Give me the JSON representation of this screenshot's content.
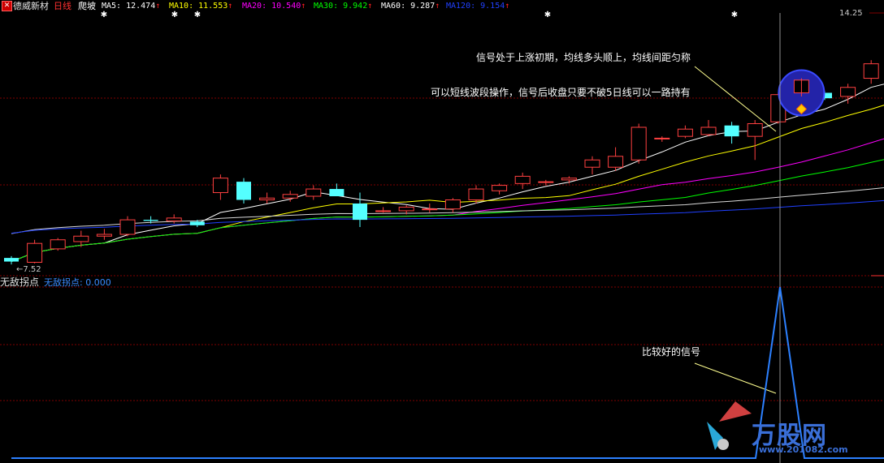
{
  "header": {
    "icon": "stock-close-icon",
    "stock_name": "德威新材",
    "period": "日线",
    "formula_name": "爬坡",
    "ma": [
      {
        "label": "MA5: 12.474",
        "color": "#ffffff"
      },
      {
        "label": "MA10: 11.553",
        "color": "#ffff00"
      },
      {
        "label": "MA20: 10.540",
        "color": "#ff00ff"
      },
      {
        "label": "MA30: 9.942",
        "color": "#00ff00"
      },
      {
        "label": "MA60: 9.287",
        "color": "#ffffff"
      },
      {
        "label": "MA120: 9.154",
        "color": "#2040ff"
      }
    ],
    "arrow": "↑",
    "arrow_color": "#ff2020"
  },
  "price_panel": {
    "high_label": "14.25",
    "low_label": "7.52",
    "annotations": {
      "note1": "信号处于上涨初期，均线多头顺上，均线间距匀称",
      "note2": "可以短线波段操作，信号后收盘只要不破5日线可以一路持有"
    }
  },
  "indicator_panel": {
    "title": "无敌拐点",
    "value_label": "无敌拐点: 0.000",
    "annotation": "比较好的信号"
  },
  "watermark": {
    "text": "万股网",
    "url": "www.201082.com"
  },
  "colors": {
    "up": "#ff4040",
    "down": "#54ffff",
    "grid": "#800000",
    "indicator": "#2c80ff"
  },
  "chart_data": {
    "type": "candlestick",
    "ohlc": [
      [
        7.7,
        7.75,
        7.52,
        7.6
      ],
      [
        7.58,
        8.2,
        7.55,
        8.1
      ],
      [
        7.95,
        8.25,
        7.9,
        8.2
      ],
      [
        8.15,
        8.45,
        8.0,
        8.3
      ],
      [
        8.3,
        8.5,
        8.2,
        8.35
      ],
      [
        8.35,
        8.85,
        8.3,
        8.75
      ],
      [
        8.75,
        8.85,
        8.65,
        8.72
      ],
      [
        8.72,
        8.9,
        8.65,
        8.8
      ],
      [
        8.7,
        8.75,
        8.55,
        8.6
      ],
      [
        9.5,
        10.0,
        9.3,
        9.9
      ],
      [
        9.8,
        9.9,
        9.2,
        9.3
      ],
      [
        9.3,
        9.5,
        9.2,
        9.35
      ],
      [
        9.35,
        9.55,
        9.25,
        9.45
      ],
      [
        9.4,
        9.7,
        9.3,
        9.6
      ],
      [
        9.6,
        9.75,
        9.4,
        9.4
      ],
      [
        9.2,
        9.5,
        8.55,
        8.75
      ],
      [
        9.0,
        9.1,
        8.95,
        9.0
      ],
      [
        9.0,
        9.15,
        8.9,
        9.1
      ],
      [
        9.05,
        9.2,
        8.95,
        9.05
      ],
      [
        9.05,
        9.35,
        8.95,
        9.3
      ],
      [
        9.3,
        9.7,
        9.2,
        9.6
      ],
      [
        9.55,
        9.75,
        9.45,
        9.7
      ],
      [
        9.75,
        10.05,
        9.6,
        9.95
      ],
      [
        9.8,
        9.85,
        9.7,
        9.8
      ],
      [
        9.85,
        9.95,
        9.75,
        9.9
      ],
      [
        10.2,
        10.5,
        10.0,
        10.4
      ],
      [
        10.2,
        10.75,
        10.1,
        10.5
      ],
      [
        10.4,
        11.4,
        10.3,
        11.3
      ],
      [
        11.0,
        11.05,
        10.9,
        11.0
      ],
      [
        11.05,
        11.35,
        11.0,
        11.25
      ],
      [
        11.1,
        11.5,
        11.05,
        11.3
      ],
      [
        11.35,
        11.45,
        10.85,
        11.05
      ],
      [
        11.05,
        11.5,
        10.4,
        11.4
      ],
      [
        11.45,
        12.25,
        11.4,
        12.2
      ],
      [
        12.6,
        12.65,
        12.15,
        12.25
      ],
      [
        12.25,
        12.3,
        12.05,
        12.1
      ],
      [
        12.15,
        12.5,
        11.95,
        12.4
      ],
      [
        12.65,
        13.15,
        12.5,
        13.05
      ],
      [
        12.9,
        13.1,
        12.8,
        13.0
      ],
      [
        13.4,
        14.0,
        13.3,
        13.85
      ],
      [
        13.45,
        14.25,
        13.4,
        14.15
      ]
    ],
    "indicator": {
      "name": "无敌拐点",
      "signal_bar": 34,
      "value": 0.0
    }
  }
}
